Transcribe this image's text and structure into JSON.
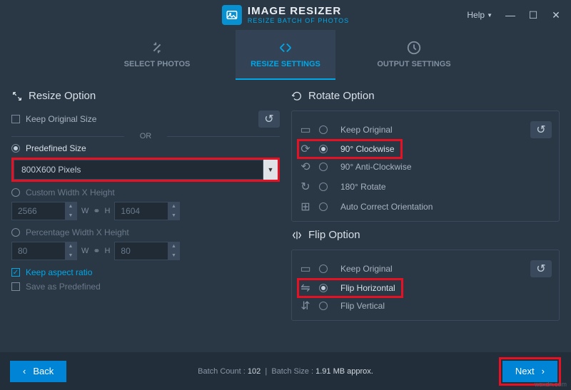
{
  "app": {
    "title": "IMAGE RESIZER",
    "subtitle": "RESIZE BATCH OF PHOTOS"
  },
  "titlebar": {
    "help": "Help"
  },
  "tabs": {
    "select": "SELECT PHOTOS",
    "resize": "RESIZE SETTINGS",
    "output": "OUTPUT SETTINGS"
  },
  "resize": {
    "header": "Resize Option",
    "keep_original": "Keep Original Size",
    "or": "OR",
    "predefined": "Predefined Size",
    "predefined_value": "800X600 Pixels",
    "custom": "Custom Width X Height",
    "custom_w": "2566",
    "custom_h": "1604",
    "percent": "Percentage Width X Height",
    "percent_w": "80",
    "percent_h": "80",
    "w": "W",
    "h": "H",
    "aspect": "Keep aspect ratio",
    "save_pre": "Save as Predefined"
  },
  "rotate": {
    "header": "Rotate Option",
    "keep": "Keep Original",
    "cw": "90° Clockwise",
    "acw": "90° Anti-Clockwise",
    "r180": "180° Rotate",
    "auto": "Auto Correct Orientation"
  },
  "flip": {
    "header": "Flip Option",
    "keep": "Keep Original",
    "h": "Flip Horizontal",
    "v": "Flip Vertical"
  },
  "footer": {
    "back": "Back",
    "next": "Next",
    "count_label": "Batch Count :",
    "count": "102",
    "size_label": "Batch Size :",
    "size": "1.91 MB approx."
  },
  "watermark": "wsxdn.com"
}
